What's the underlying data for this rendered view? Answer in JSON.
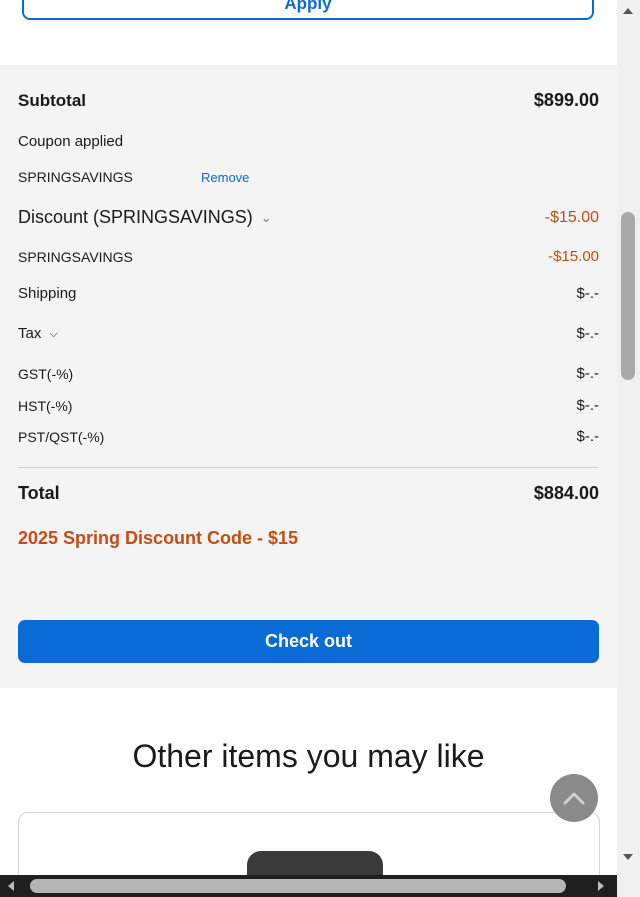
{
  "coupon": {
    "apply_label": "Apply"
  },
  "summary": {
    "subtotal_label": "Subtotal",
    "subtotal_value": "$899.00",
    "coupon_applied_label": "Coupon applied",
    "coupon_code": "SPRINGSAVINGS",
    "remove_label": "Remove",
    "discount_label": "Discount (SPRINGSAVINGS)",
    "discount_value": "-$15.00",
    "discount_detail_code": "SPRINGSAVINGS",
    "discount_detail_value": "-$15.00",
    "shipping_label": "Shipping",
    "shipping_value": "$-.-",
    "tax_label": "Tax",
    "tax_value": "$-.-",
    "gst_label": "GST(-%)",
    "gst_value": "$-.-",
    "hst_label": "HST(-%)",
    "hst_value": "$-.-",
    "pst_label": "PST/QST(-%)",
    "pst_value": "$-.-",
    "total_label": "Total",
    "total_value": "$884.00",
    "promo_text": "2025 Spring Discount Code - $15",
    "checkout_label": "Check out"
  },
  "recommendations": {
    "title": "Other items you may like"
  },
  "colors": {
    "accent": "#0a6bd6",
    "discount": "#c44d12",
    "summary_bg": "#f4f4f4"
  },
  "icons": {
    "discount_toggle": "chevron-down-icon",
    "tax_toggle": "chevron-down-icon",
    "scroll_top": "chevron-up-icon"
  }
}
